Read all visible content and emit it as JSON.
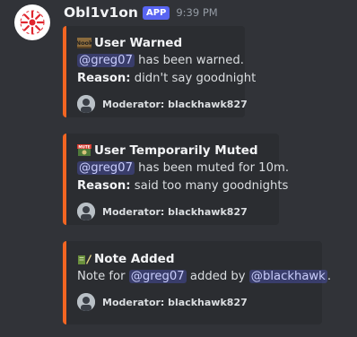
{
  "message": {
    "username": "Obl1v1on",
    "badge": "APP",
    "timestamp": "9:39 PM",
    "avatar_icon": "red-spiral-logo-icon"
  },
  "embeds": [
    {
      "title_icon": "nook-sign-icon",
      "title_icon_text": "Nook",
      "title": "User Warned",
      "mention": "@greg07",
      "action_text": " has been warned.",
      "reason_label": "Reason:",
      "reason_text": " didn't say goodnight",
      "footer": "Moderator: blackhawk827",
      "accent": "#f26522"
    },
    {
      "title_icon": "mute-sign-icon",
      "title_icon_text": "MUTE",
      "title": "User Temporarily Muted",
      "mention": "@greg07",
      "action_text": " has been muted for 10m.",
      "reason_label": "Reason:",
      "reason_text": " said too many goodnights",
      "footer": "Moderator: blackhawk827",
      "accent": "#f26522"
    },
    {
      "title_icon": "note-icon",
      "title": "Note Added",
      "prefix_text": "Note for ",
      "mention": "@greg07",
      "middle_text": " added by ",
      "mention2": "@blackhawk",
      "suffix_text": ".",
      "footer": "Moderator: blackhawk827",
      "accent": "#f26522"
    }
  ]
}
